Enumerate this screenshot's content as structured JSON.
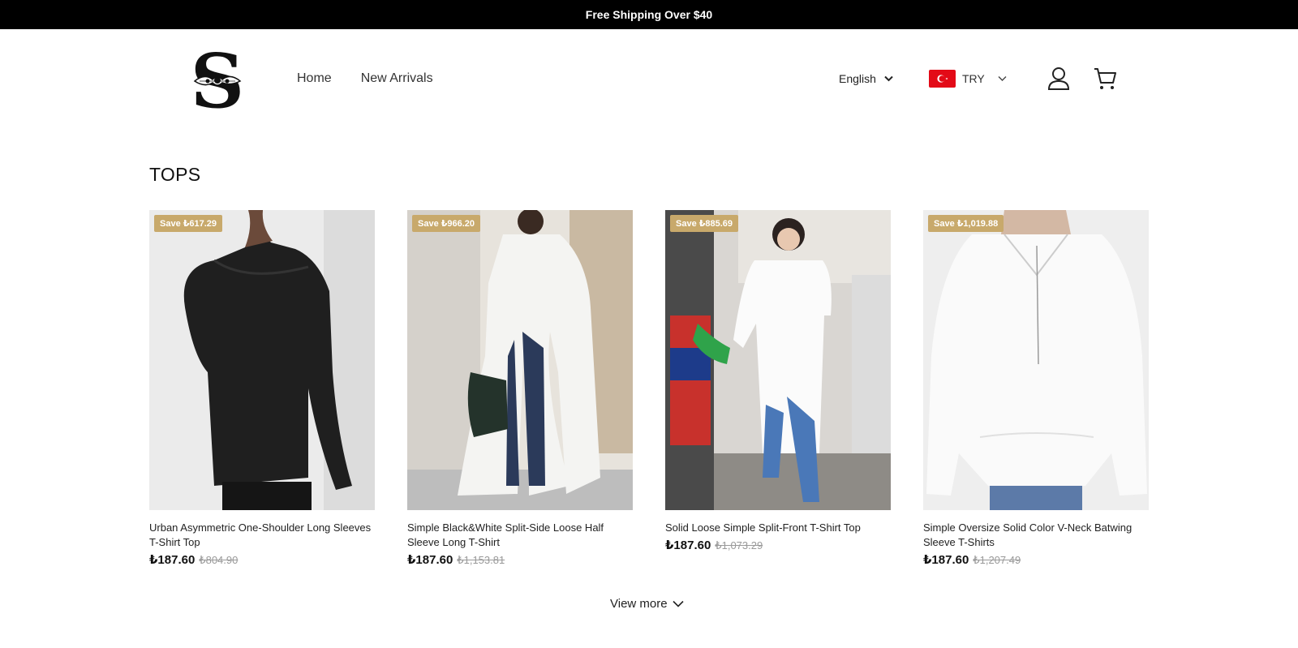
{
  "announcement": "Free Shipping Over $40",
  "nav": {
    "items": [
      "Home",
      "New Arrivals"
    ]
  },
  "language": {
    "selected": "English"
  },
  "currency": {
    "selected": "TRY"
  },
  "section": {
    "title": "TOPS"
  },
  "products": [
    {
      "badge": "Save ₺617.29",
      "title": "Urban Asymmetric One-Shoulder Long Sleeves T-Shirt Top",
      "price": "₺187.60",
      "old_price": "₺804.90"
    },
    {
      "badge": "Save ₺966.20",
      "title": "Simple Black&White Split-Side Loose Half Sleeve Long T-Shirt",
      "price": "₺187.60",
      "old_price": "₺1,153.81"
    },
    {
      "badge": "Save ₺885.69",
      "title": "Solid Loose Simple Split-Front T-Shirt Top",
      "price": "₺187.60",
      "old_price": "₺1,073.29"
    },
    {
      "badge": "Save ₺1,019.88",
      "title": "Simple Oversize Solid Color V-Neck Batwing Sleeve T-Shirts",
      "price": "₺187.60",
      "old_price": "₺1,207.49"
    }
  ],
  "view_more": "View more",
  "colors": {
    "badge": "#c8a96b",
    "announcement_bg": "#000000",
    "flag": "#e30a17"
  }
}
